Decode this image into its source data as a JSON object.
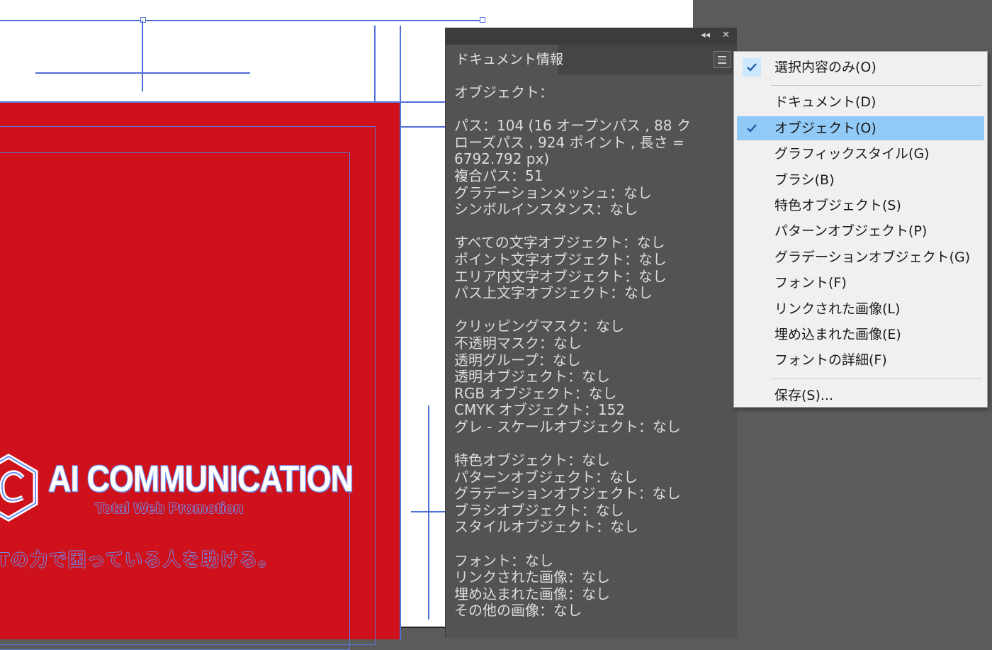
{
  "colors": {
    "workspace": "#5b5b5b",
    "artboard": "#ffffff",
    "card_red": "#cf111b",
    "guide_blue": "#4f6fd6",
    "panel_bg": "#535353",
    "menu_bg": "#f0f0f0",
    "menu_highlight": "#91c9f7"
  },
  "artwork": {
    "logo_title": "AI COMMUNICATION",
    "logo_subtitle": "Total Web Promotion",
    "tagline": "Tの力で困っている人を助ける。"
  },
  "panel": {
    "collapse_icon": "double-chevron-left-icon",
    "close_icon": "close-icon",
    "tab_label": "ドキュメント情報",
    "menu_icon": "hamburger-icon",
    "lines": [
      "オブジェクト：",
      "",
      "パス：104 (16 オープンパス , 88 ク",
      "ローズパス , 924 ポイント , 長さ =",
      "6792.792 px)",
      "複合パス：51",
      "グラデーションメッシュ：なし",
      "シンボルインスタンス：なし",
      "",
      "すべての文字オブジェクト：なし",
      "ポイント文字オブジェクト：なし",
      "エリア内文字オブジェクト：なし",
      "パス上文字オブジェクト：なし",
      "",
      "クリッピングマスク：なし",
      "不透明マスク：なし",
      "透明グループ：なし",
      "透明オブジェクト：なし",
      "RGB オブジェクト：なし",
      "CMYK オブジェクト：152",
      "グレ - スケールオブジェクト：なし",
      "",
      "特色オブジェクト：なし",
      "パターンオブジェクト：なし",
      "グラデーションオブジェクト：なし",
      "ブラシオブジェクト：なし",
      "スタイルオブジェクト：なし",
      "",
      "フォント：なし",
      "リンクされた画像：なし",
      "埋め込まれた画像：なし",
      "その他の画像：なし"
    ]
  },
  "menu": {
    "check_icon": "checkmark-icon",
    "items": [
      {
        "label": "選択内容のみ(O)",
        "checked": true,
        "highlight": false
      },
      {
        "separator": true
      },
      {
        "label": "ドキュメント(D)",
        "checked": false,
        "highlight": false
      },
      {
        "label": "オブジェクト(O)",
        "checked": true,
        "highlight": true
      },
      {
        "label": "グラフィックスタイル(G)",
        "checked": false,
        "highlight": false
      },
      {
        "label": "ブラシ(B)",
        "checked": false,
        "highlight": false
      },
      {
        "label": "特色オブジェクト(S)",
        "checked": false,
        "highlight": false
      },
      {
        "label": "パターンオブジェクト(P)",
        "checked": false,
        "highlight": false
      },
      {
        "label": "グラデーションオブジェクト(G)",
        "checked": false,
        "highlight": false
      },
      {
        "label": "フォント(F)",
        "checked": false,
        "highlight": false
      },
      {
        "label": "リンクされた画像(L)",
        "checked": false,
        "highlight": false
      },
      {
        "label": "埋め込まれた画像(E)",
        "checked": false,
        "highlight": false
      },
      {
        "label": "フォントの詳細(F)",
        "checked": false,
        "highlight": false
      },
      {
        "separator": true
      },
      {
        "label": "保存(S)...",
        "checked": false,
        "highlight": false
      }
    ]
  }
}
